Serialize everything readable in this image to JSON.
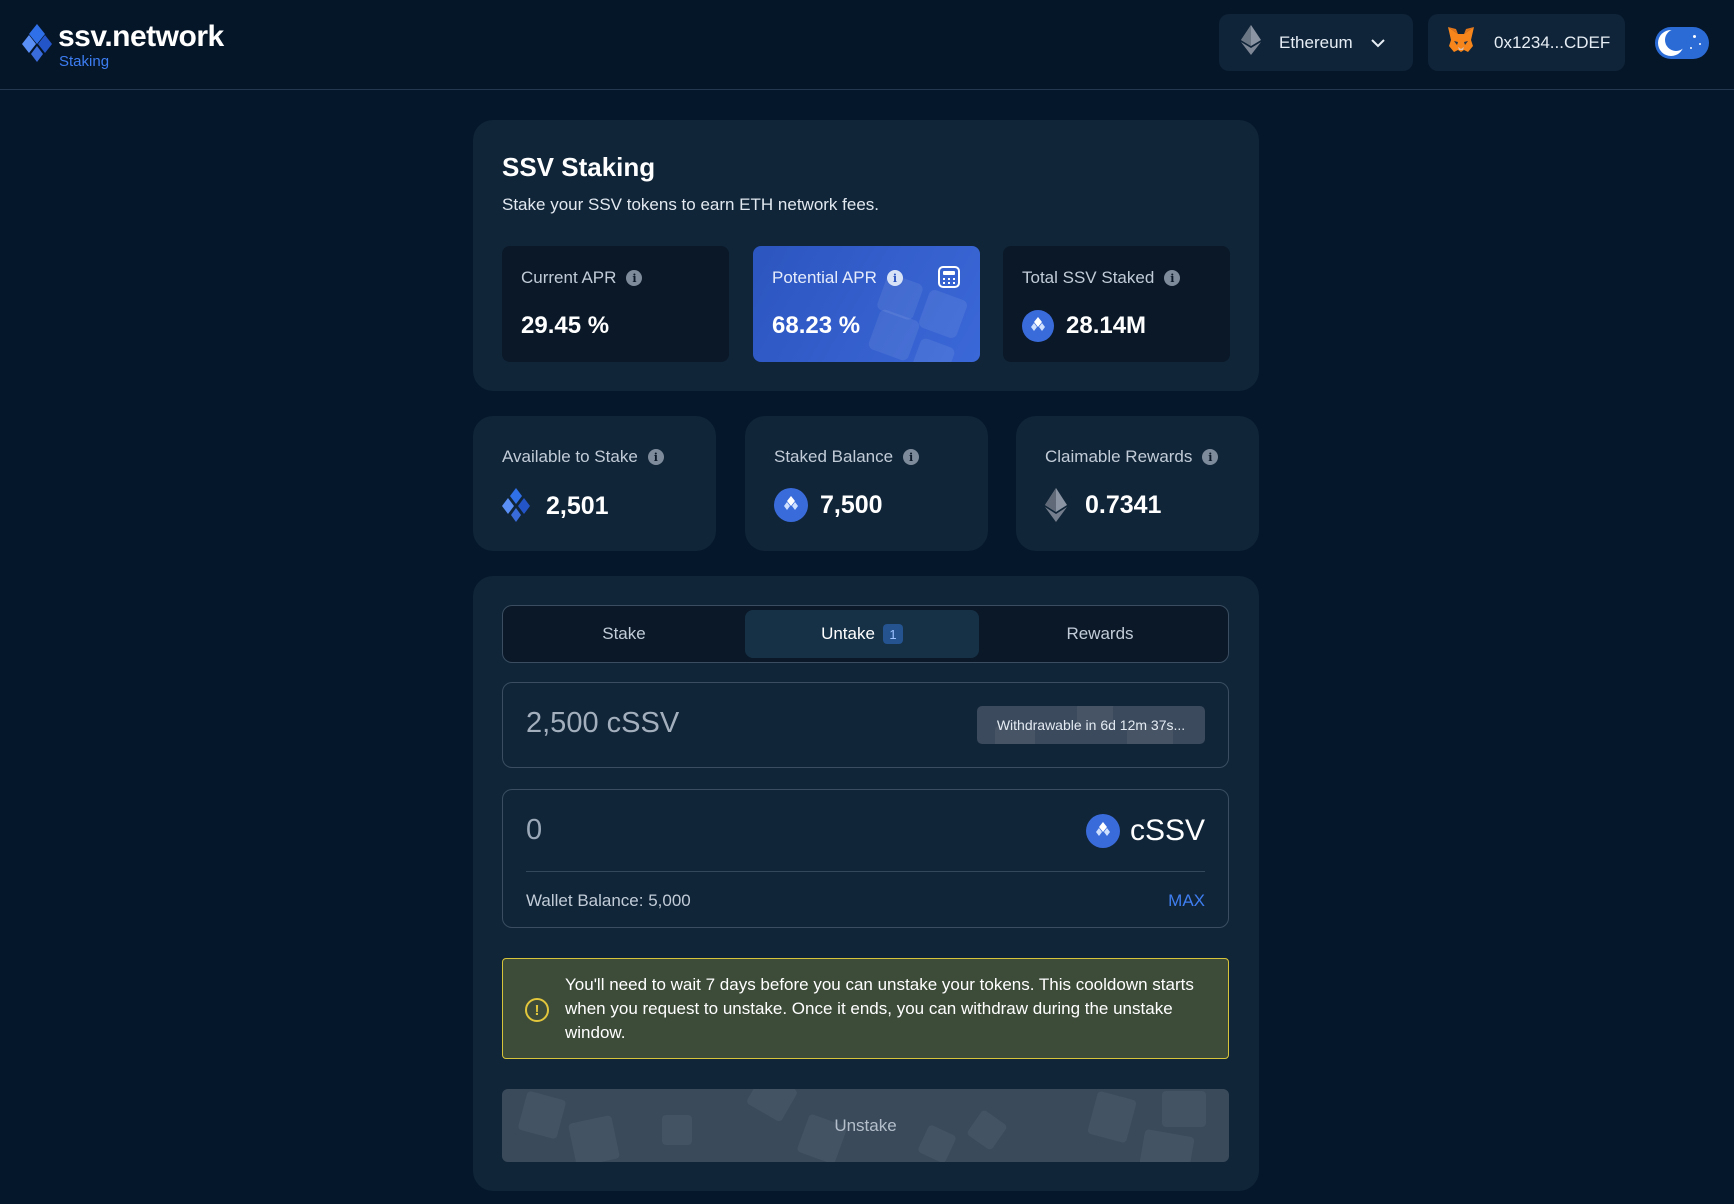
{
  "header": {
    "brand": "ssv.network",
    "brand_sub": "Staking",
    "network_label": "Ethereum",
    "wallet_address": "0x1234...CDEF"
  },
  "staking": {
    "title": "SSV Staking",
    "subtitle": "Stake your SSV tokens to earn ETH network fees.",
    "stats": {
      "current_apr": {
        "label": "Current APR",
        "value": "29.45 %"
      },
      "potential_apr": {
        "label": "Potential APR",
        "value": "68.23 %"
      },
      "total_staked": {
        "label": "Total SSV Staked",
        "value": "28.14M"
      }
    }
  },
  "balances": {
    "available": {
      "label": "Available to Stake",
      "value": "2,501"
    },
    "staked": {
      "label": "Staked Balance",
      "value": "7,500"
    },
    "rewards": {
      "label": "Claimable Rewards",
      "value": "0.7341"
    }
  },
  "tabs": {
    "stake": "Stake",
    "unstake": "Untake",
    "unstake_badge": "1",
    "rewards": "Rewards"
  },
  "request": {
    "amount": "2,500 cSSV",
    "status": "Withdrawable in 6d 12m 37s..."
  },
  "amount_input": {
    "value": "0",
    "token": "cSSV",
    "wallet_balance": "Wallet Balance: 5,000",
    "max_label": "MAX"
  },
  "warning": {
    "text": "You'll need to wait 7 days before you can unstake your tokens. This cooldown starts when you request to unstake. Once it ends, you can withdraw during the unstake window."
  },
  "actions": {
    "unstake_label": "Unstake"
  },
  "colors": {
    "background": "#05172a",
    "card": "#102538",
    "accent": "#3a6bdb",
    "warning_border": "#d7c43a"
  }
}
